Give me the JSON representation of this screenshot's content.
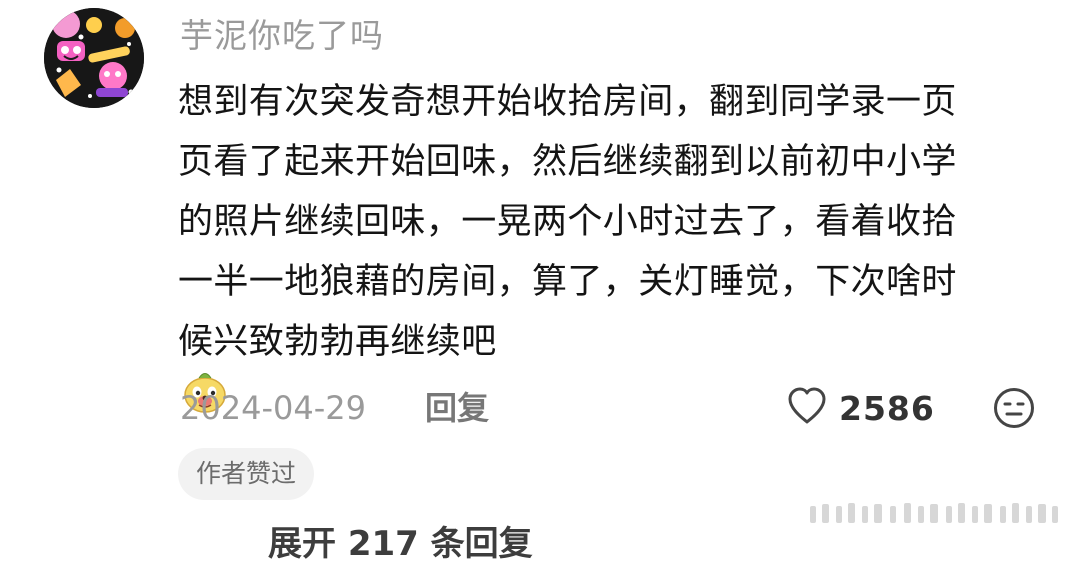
{
  "comment": {
    "username": "芋泥你吃了吗",
    "content_lines": [
      "想到有次突发奇想开始收拾房间，翻到同学录一页",
      "页看了起来开始回味，然后继续翻到以前初中小学",
      "的照片继续回味，一晃两个小时过去了，看着收拾",
      "一半一地狼藉的房间，算了，关灯睡觉，下次啥时",
      "候兴致勃勃再继续吧"
    ],
    "emoji_icon": "smirk-dog-emoji",
    "date": "2024-04-29",
    "reply_label": "回复",
    "likes": "2586",
    "author_badge": "作者赞过",
    "expand_replies": "展开 217 条回复"
  },
  "icons": {
    "like": "heart-outline-icon",
    "dislike": "neutral-face-icon",
    "avatar": "avatar-image"
  },
  "colors": {
    "text_primary": "#141414",
    "text_secondary": "#9a9a9a",
    "badge_bg": "#f2f2f2"
  }
}
